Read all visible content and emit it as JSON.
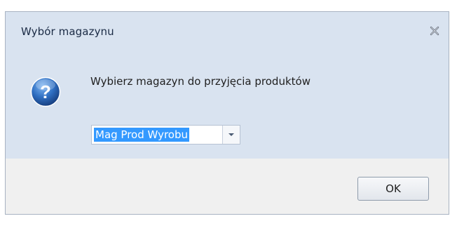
{
  "window": {
    "title": "Wybór magazynu"
  },
  "dialog": {
    "icon": "question-icon",
    "prompt": "Wybierz magazyn do przyjęcia produktów",
    "warehouse_select": {
      "selected": "Mag Prod Wyrobu"
    },
    "ok_label": "OK"
  },
  "colors": {
    "title_bg": "#d9e3f0",
    "footer_bg": "#f0f0f0",
    "selection": "#3399ff",
    "icon_blue": "#2f6fc2"
  }
}
